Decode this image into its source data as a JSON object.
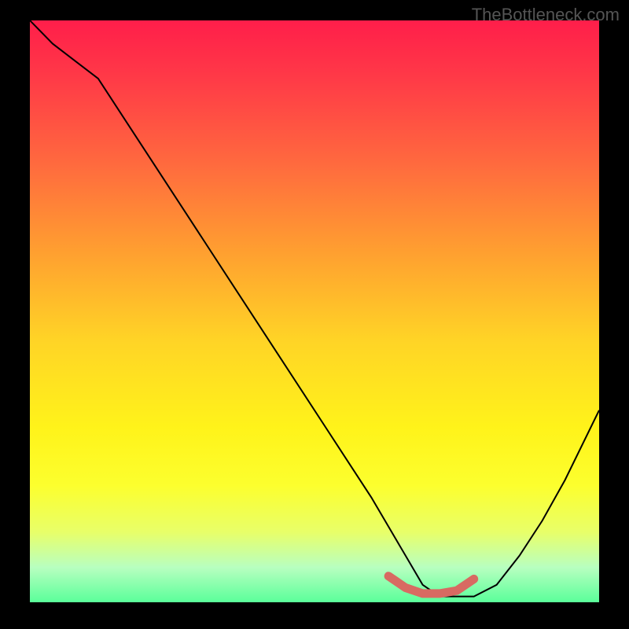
{
  "watermark": "TheBottleneck.com",
  "chart_data": {
    "type": "line",
    "title": "",
    "xlabel": "",
    "ylabel": "",
    "xlim": [
      0,
      100
    ],
    "ylim": [
      0,
      100
    ],
    "grid": false,
    "legend": false,
    "background_gradient": {
      "top": "#ff1e4a",
      "middle": "#fff31a",
      "bottom": "#5aff9a"
    },
    "series": [
      {
        "name": "curve",
        "color": "#000000",
        "stroke_width": 2,
        "x": [
          0,
          4,
          8,
          12,
          16,
          20,
          24,
          28,
          32,
          36,
          40,
          44,
          48,
          52,
          56,
          60,
          63,
          66,
          69,
          72,
          75,
          78,
          82,
          86,
          90,
          94,
          98,
          100
        ],
        "y": [
          100,
          96,
          93,
          90,
          84,
          78,
          72,
          66,
          60,
          54,
          48,
          42,
          36,
          30,
          24,
          18,
          13,
          8,
          3,
          1,
          1,
          1,
          3,
          8,
          14,
          21,
          29,
          33
        ]
      },
      {
        "name": "highlight",
        "color": "#d86a62",
        "stroke_width": 10,
        "x": [
          63,
          66,
          69,
          72,
          75,
          78
        ],
        "y": [
          4.5,
          2.5,
          1.5,
          1.5,
          2.0,
          4.0
        ]
      }
    ]
  }
}
